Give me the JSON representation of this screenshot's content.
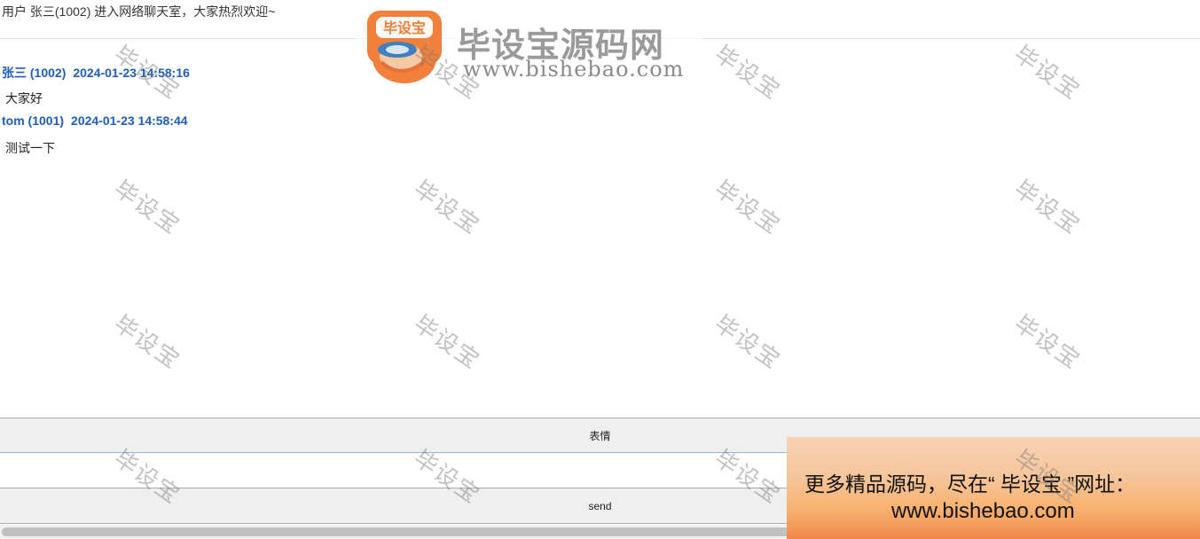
{
  "notice": {
    "text": "用户 张三(1002) 进入网络聊天室，大家热烈欢迎~"
  },
  "messages": [
    {
      "user": "张三 (1002)",
      "time": "2024-01-23 14:58:16",
      "text": "大家好"
    },
    {
      "user": "tom (1001)",
      "time": "2024-01-23 14:58:44",
      "text": "测试一下"
    }
  ],
  "emoji_button": {
    "label": "表情"
  },
  "message_input": {
    "value": "",
    "placeholder": ""
  },
  "send_button": {
    "label": "send"
  },
  "logo": {
    "badge": "毕设宝",
    "title": "毕设宝源码网",
    "url": "www.bishebao.com"
  },
  "promo": {
    "line1": "更多精品源码，尽在“ 毕设宝 ”网址：",
    "line2": "www.bishebao.com"
  },
  "watermark": {
    "text": "毕设宝"
  },
  "colors": {
    "username": "#1f5dbb",
    "button_bg": "#efefef",
    "logo_orange": "#f0803a",
    "logo_blue": "#3f7fc4"
  },
  "icons": {
    "logo": "brand-logo-icon"
  }
}
